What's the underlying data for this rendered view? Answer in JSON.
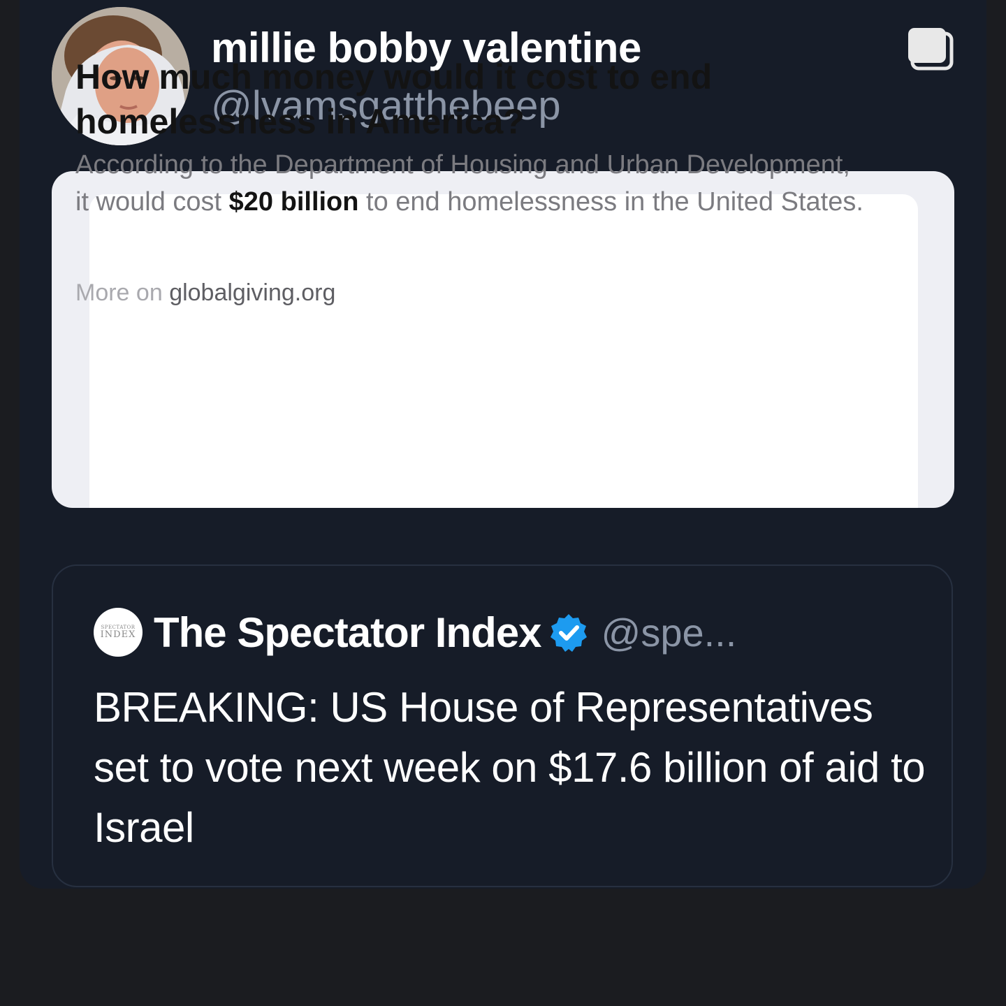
{
  "post": {
    "author": {
      "display_name": "millie bobby valentine",
      "handle": "@lvamsgatthebeep",
      "avatar": "profile-photo"
    },
    "action_icon": "copy-icon"
  },
  "answer_card": {
    "question": "How much money would it cost to end homelessness in America?",
    "answer_before": "According to the Department of Housing and Urban Development, it would cost ",
    "answer_highlight": "$20 billion",
    "answer_after": " to end homelessness in the United States.",
    "source_prefix": "More on ",
    "source_domain": "globalgiving.org"
  },
  "quoted_post": {
    "avatar_text_top": "SPECTATOR",
    "avatar_text_main": "INDEX",
    "display_name": "The Spectator Index",
    "verified_icon": "verified-badge-icon",
    "handle": "@spe...",
    "text": "BREAKING: US House of Representatives set to vote next week on $17.6 billion of aid to Israel"
  },
  "colors": {
    "post_background": "#161c28",
    "page_background": "#1b1c20",
    "handle_gray": "#8b95a6",
    "verified_blue": "#1d9bf0"
  }
}
